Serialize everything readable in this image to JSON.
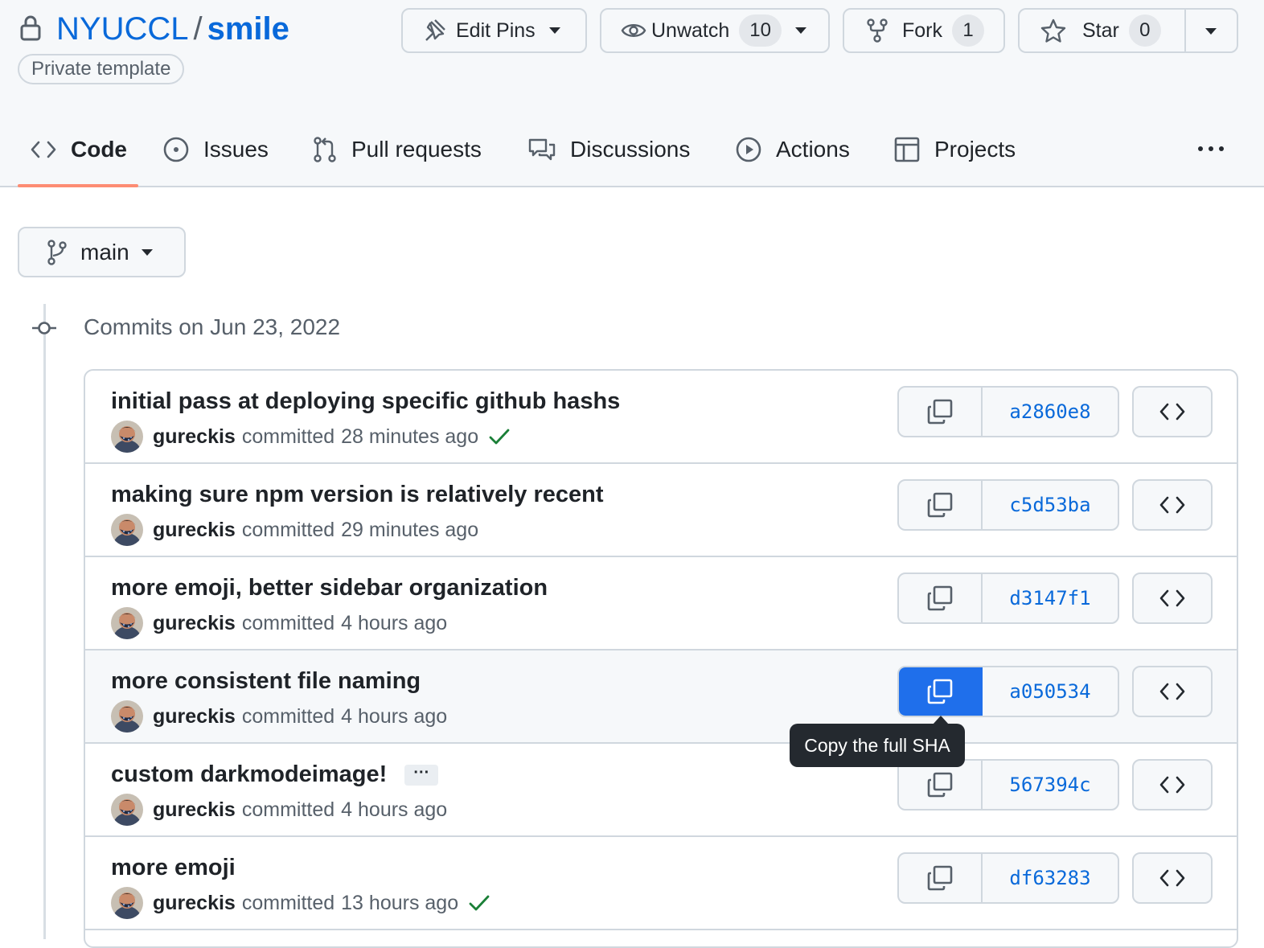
{
  "repo": {
    "owner": "NYUCCL",
    "separator": "/",
    "name": "smile",
    "visibility": "Private template"
  },
  "actions": {
    "edit_pins": "Edit Pins",
    "unwatch": "Unwatch",
    "unwatch_count": "10",
    "fork": "Fork",
    "fork_count": "1",
    "star": "Star",
    "star_count": "0"
  },
  "tabs": [
    {
      "label": "Code",
      "icon": "code-icon",
      "active": true
    },
    {
      "label": "Issues",
      "icon": "issue-opened-icon"
    },
    {
      "label": "Pull requests",
      "icon": "git-pull-request-icon"
    },
    {
      "label": "Discussions",
      "icon": "comment-discussion-icon"
    },
    {
      "label": "Actions",
      "icon": "play-icon"
    },
    {
      "label": "Projects",
      "icon": "table-icon"
    }
  ],
  "branch": "main",
  "commits_heading": "Commits on Jun 23, 2022",
  "commits": [
    {
      "message": "initial pass at deploying specific github hashs",
      "author": "gureckis",
      "verb": "committed",
      "time": "28 minutes ago",
      "check": true,
      "sha": "a2860e8"
    },
    {
      "message": "making sure npm version is relatively recent",
      "author": "gureckis",
      "verb": "committed",
      "time": "29 minutes ago",
      "check": false,
      "sha": "c5d53ba"
    },
    {
      "message": "more emoji, better sidebar organization",
      "author": "gureckis",
      "verb": "committed",
      "time": "4 hours ago",
      "check": false,
      "sha": "d3147f1"
    },
    {
      "message": "more consistent file naming",
      "author": "gureckis",
      "verb": "committed",
      "time": "4 hours ago",
      "check": false,
      "sha": "a050534"
    },
    {
      "message": "custom darkmodeimage!",
      "author": "gureckis",
      "verb": "committed",
      "time": "4 hours ago",
      "check": false,
      "sha": "567394c",
      "ellipsis": "···"
    },
    {
      "message": "more emoji",
      "author": "gureckis",
      "verb": "committed",
      "time": "13 hours ago",
      "check": true,
      "sha": "df63283"
    }
  ],
  "tooltip": "Copy the full SHA",
  "colors": {
    "link": "#0969da",
    "accent": "#1f6feb",
    "tab_underline": "#fd8c73",
    "success": "#1a7f37"
  }
}
